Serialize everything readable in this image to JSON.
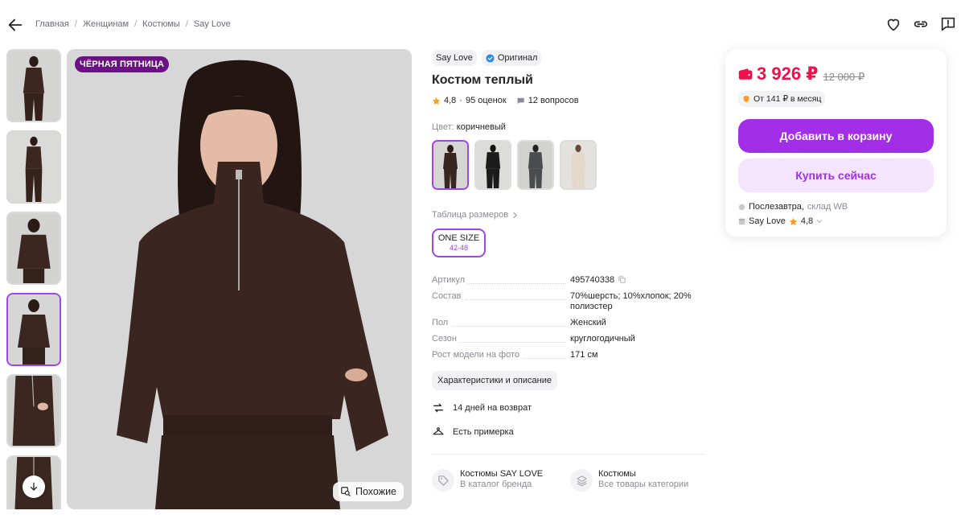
{
  "breadcrumbs": [
    "Главная",
    "Женщинам",
    "Костюмы",
    "Say Love"
  ],
  "gallery": {
    "badge": "ЧЁРНАЯ ПЯТНИЦА",
    "similar_label": "Похожие",
    "thumbnail_count": 6,
    "active_thumbnail": 4
  },
  "product": {
    "brand": "Say Love",
    "original_label": "Оригинал",
    "title": "Костюм теплый",
    "rating": "4,8",
    "reviews": "95 оценок",
    "questions": "12 вопросов",
    "color_label": "Цвет:",
    "color_value": "коричневый",
    "color_options": [
      "#3a2620",
      "#1b1b1b",
      "#4a4d4f",
      "#e5d8c8"
    ],
    "size_table_label": "Таблица размеров",
    "size": {
      "name": "ONE SIZE",
      "range": "42-48"
    },
    "specs": [
      {
        "key": "Артикул",
        "value": "495740338"
      },
      {
        "key": "Состав",
        "value": "70%шерсть; 10%хлопок; 20% полиэстер"
      },
      {
        "key": "Пол",
        "value": "Женский"
      },
      {
        "key": "Сезон",
        "value": "круглогодичный"
      },
      {
        "key": "Рост модели на фото",
        "value": "171 см"
      }
    ],
    "description_button": "Характеристики и описание",
    "features": [
      "14 дней на возврат",
      "Есть примерка"
    ],
    "categories": [
      {
        "title": "Костюмы SAY LOVE",
        "subtitle": "В каталог бренда"
      },
      {
        "title": "Костюмы",
        "subtitle": "Все товары категории"
      }
    ]
  },
  "purchase": {
    "price": "3 926 ₽",
    "old_price": "12 000 ₽",
    "installment": "От 141 ₽ в месяц",
    "add_to_cart": "Добавить в корзину",
    "buy_now": "Купить сейчас",
    "delivery_day": "Послезавтра,",
    "delivery_place": "склад WB",
    "seller": "Say Love",
    "seller_rating": "4,8"
  },
  "colors": {
    "accent": "#a32ee7",
    "price": "#f0104a",
    "badge": "#6b1185"
  }
}
